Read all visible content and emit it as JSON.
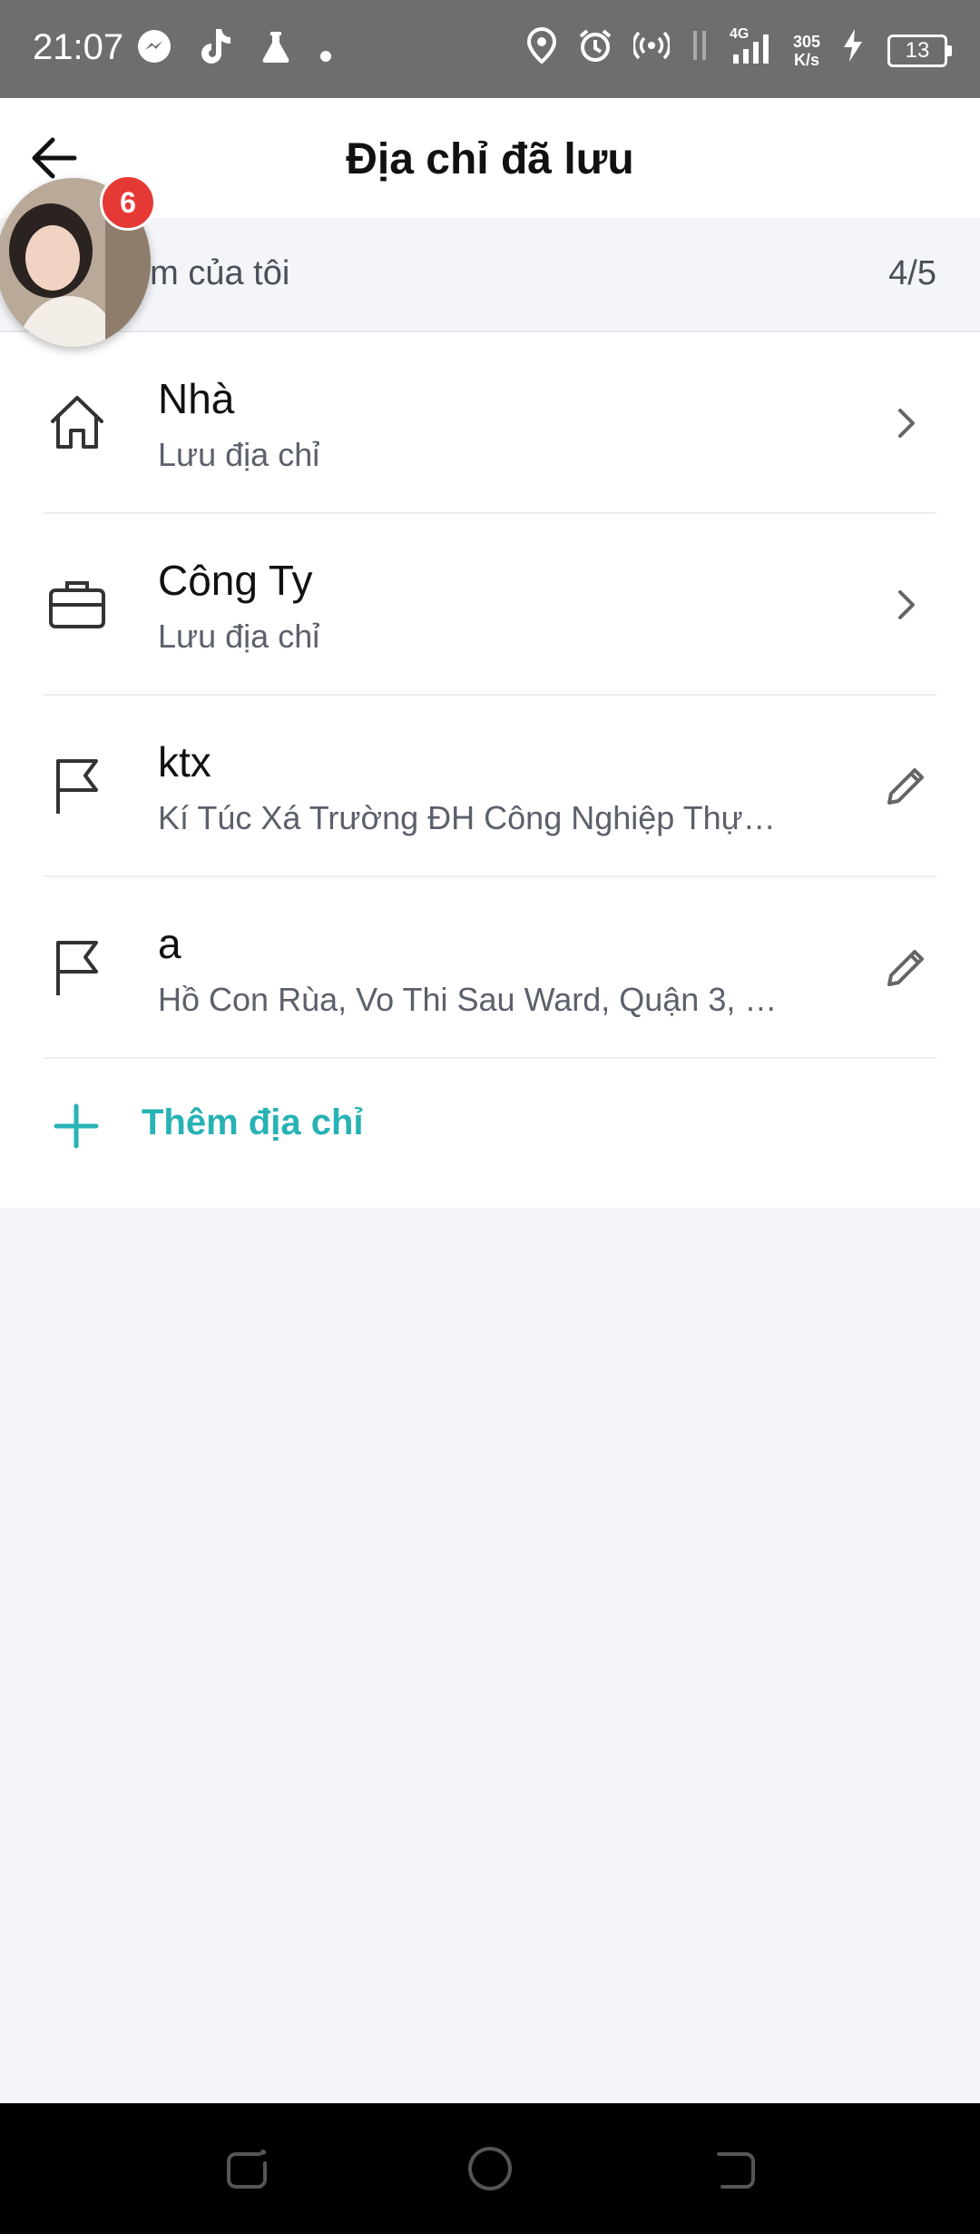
{
  "status_bar": {
    "time": "21:07",
    "net_label": "4G",
    "speed_value": "305",
    "speed_unit": "K/s",
    "battery": "13"
  },
  "header": {
    "title": "Địa chỉ đã lưu"
  },
  "bubble": {
    "badge_count": "6"
  },
  "section": {
    "title": "ểm của tôi",
    "count": "4/5"
  },
  "addresses": [
    {
      "title": "Nhà",
      "subtitle": "Lưu địa chỉ",
      "icon": "home-icon",
      "action": "chevron-right-icon"
    },
    {
      "title": "Công Ty",
      "subtitle": "Lưu địa chỉ",
      "icon": "briefcase-icon",
      "action": "chevron-right-icon"
    },
    {
      "title": "ktx",
      "subtitle": "Kí Túc Xá Trường ĐH Công Nghiệp Thự…",
      "icon": "flag-icon",
      "action": "edit-pencil-icon"
    },
    {
      "title": "a",
      "subtitle": "Hồ Con Rùa, Vo Thi Sau Ward, Quận 3, …",
      "icon": "flag-icon",
      "action": "edit-pencil-icon"
    }
  ],
  "add_address": {
    "label": "Thêm địa chỉ"
  },
  "colors": {
    "accent": "#27b2b4",
    "badge": "#e53935",
    "status_bar": "#6e6e6e",
    "background": "#f4f5f9"
  }
}
